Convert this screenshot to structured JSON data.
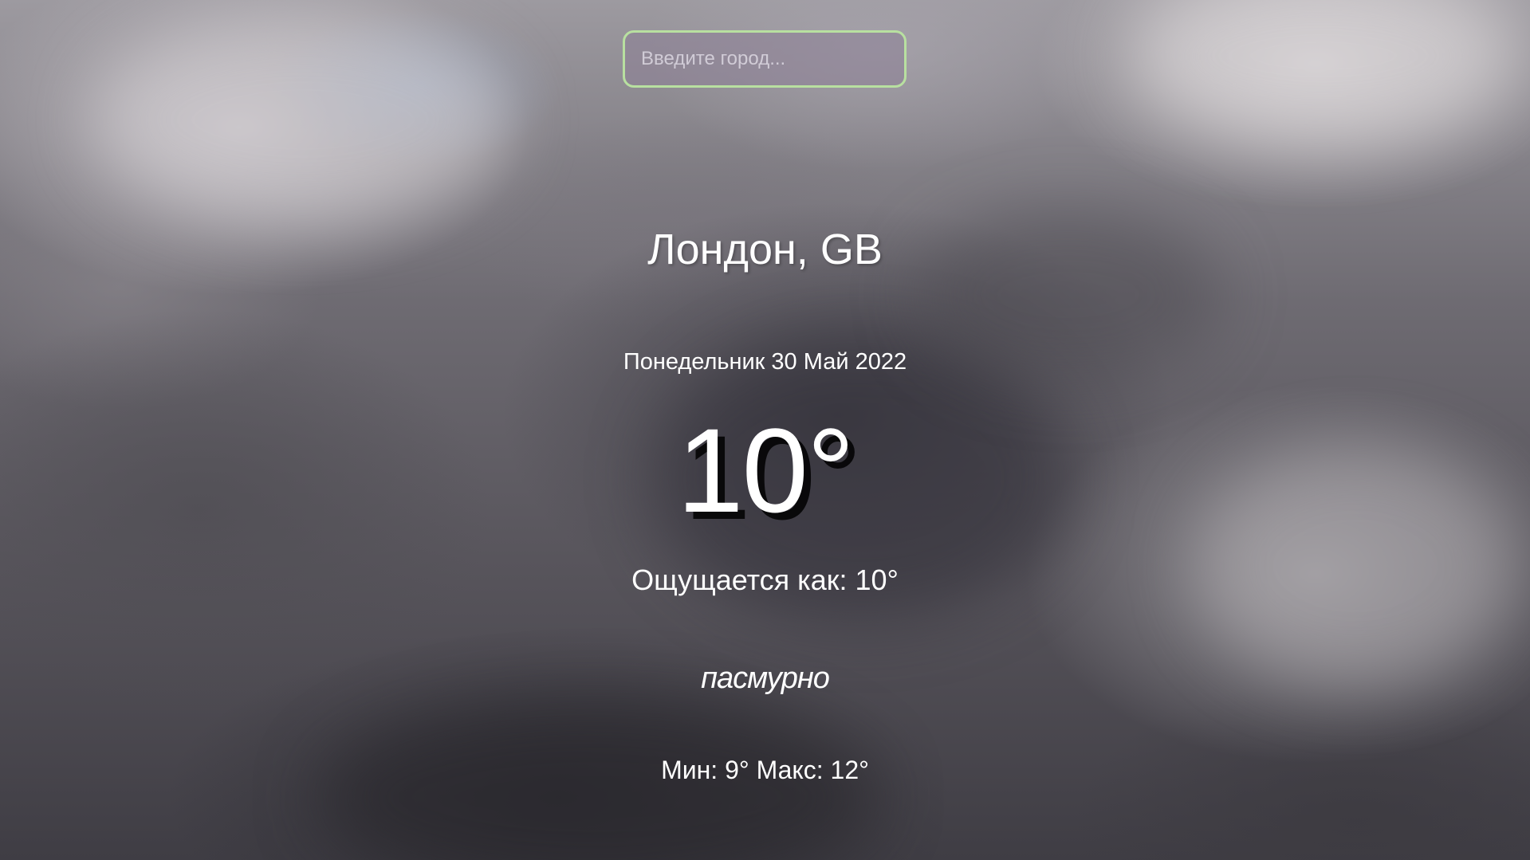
{
  "search": {
    "placeholder": "Введите город...",
    "value": ""
  },
  "weather": {
    "location": "Лондон, GB",
    "date": "Понедельник 30 Май 2022",
    "temperature": "10°",
    "feels_like": "Ощущается как: 10°",
    "description": "пасмурно",
    "min_max": "Мин: 9° Макс: 12°"
  },
  "colors": {
    "search_border": "#b8e0a0",
    "text": "#ffffff"
  }
}
